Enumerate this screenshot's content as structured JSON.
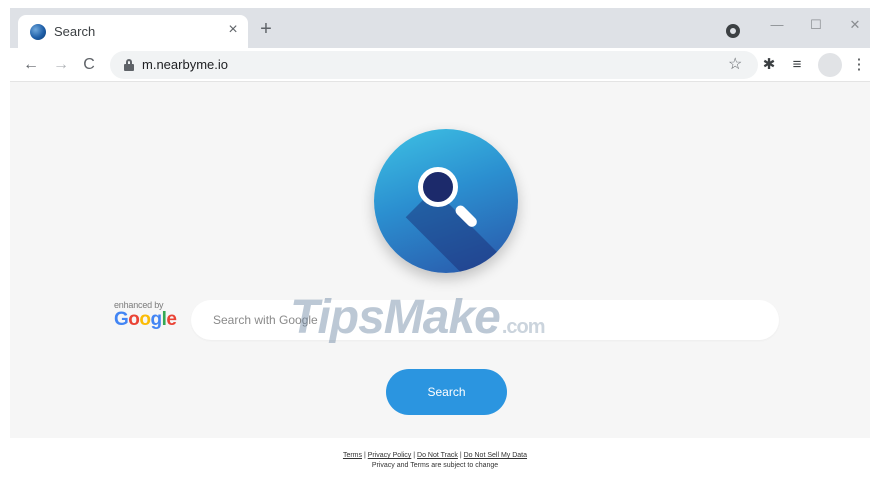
{
  "browser": {
    "tab": {
      "title": "Search",
      "close": "×"
    },
    "new_tab": "+",
    "window": {
      "minimize": "—",
      "maximize": "☐",
      "close": "✕"
    },
    "nav": {
      "back": "←",
      "forward": "→",
      "reload": "C"
    },
    "address": {
      "url": "m.nearbyme.io"
    },
    "toolbar_icons": {
      "bookmark": "☆",
      "extensions": "✱",
      "reading_list": "≡",
      "menu": "⋮"
    }
  },
  "page": {
    "enhanced_label": "enhanced by",
    "google_letters": [
      "G",
      "o",
      "o",
      "g",
      "l",
      "e"
    ],
    "search_placeholder": "Search with Google",
    "search_button": "Search",
    "watermark": {
      "main": "TipsMake",
      "suffix": ".com"
    }
  },
  "footer": {
    "links": [
      "Terms",
      "Privacy Policy",
      "Do Not Track",
      "Do Not Sell My Data"
    ],
    "separator": " | ",
    "note": "Privacy and Terms are subject to change"
  },
  "colors": {
    "accent": "#2b95e0",
    "page_bg": "#f6f6f6",
    "tabstrip": "#dee1e6"
  }
}
